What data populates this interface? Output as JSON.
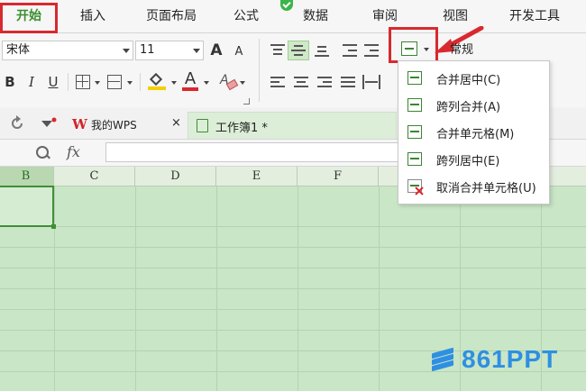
{
  "tabs": [
    "开始",
    "插入",
    "页面布局",
    "公式",
    "数据",
    "审阅",
    "视图",
    "开发工具"
  ],
  "toolbar": {
    "font_name": "宋体",
    "font_size": "11",
    "grow_font": "A",
    "shrink_font": "A",
    "bold": "B",
    "italic": "I",
    "underline": "U",
    "font_color_letter": "A",
    "number_format": "常规"
  },
  "doc_tabs": {
    "wps_logo": "W",
    "home_tab": "我的WPS",
    "close": "×",
    "workbook_tab": "工作簿1 *"
  },
  "formula_bar": {
    "fx": "fx",
    "value": ""
  },
  "columns": [
    "B",
    "C",
    "D",
    "E",
    "F"
  ],
  "merge_menu": [
    "合并居中(C)",
    "跨列合并(A)",
    "合并单元格(M)",
    "跨列居中(E)",
    "取消合并单元格(U)"
  ],
  "watermark": "861PPT",
  "colors": {
    "accent_green": "#3c8d2f",
    "highlight_red": "#d8292f",
    "grid_green": "#c9e6c6",
    "watermark_blue": "#2f8fe2"
  }
}
